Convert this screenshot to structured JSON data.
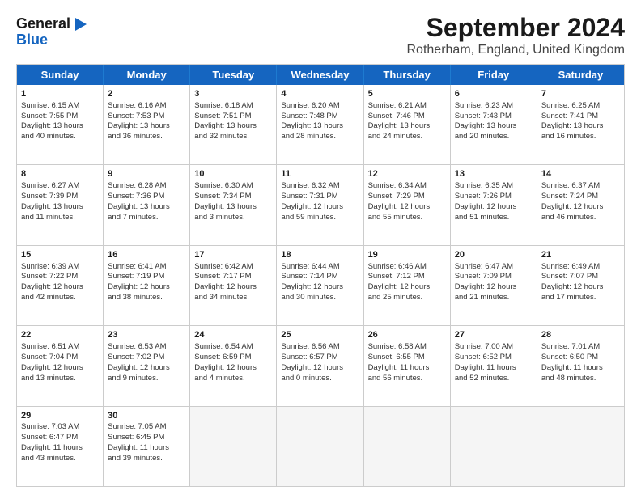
{
  "header": {
    "logo_line1": "General",
    "logo_line2": "Blue",
    "title": "September 2024",
    "subtitle": "Rotherham, England, United Kingdom"
  },
  "calendar": {
    "days_of_week": [
      "Sunday",
      "Monday",
      "Tuesday",
      "Wednesday",
      "Thursday",
      "Friday",
      "Saturday"
    ],
    "weeks": [
      [
        {
          "day": "",
          "sunrise": "",
          "sunset": "",
          "daylight": "",
          "empty": true
        },
        {
          "day": "",
          "sunrise": "",
          "sunset": "",
          "daylight": "",
          "empty": true
        },
        {
          "day": "",
          "sunrise": "",
          "sunset": "",
          "daylight": "",
          "empty": true
        },
        {
          "day": "",
          "sunrise": "",
          "sunset": "",
          "daylight": "",
          "empty": true
        },
        {
          "day": "",
          "sunrise": "",
          "sunset": "",
          "daylight": "",
          "empty": true
        },
        {
          "day": "",
          "sunrise": "",
          "sunset": "",
          "daylight": "",
          "empty": true
        },
        {
          "day": "",
          "sunrise": "",
          "sunset": "",
          "daylight": "",
          "empty": true
        }
      ],
      [
        {
          "day": "1",
          "sunrise": "Sunrise: 6:15 AM",
          "sunset": "Sunset: 7:55 PM",
          "daylight": "Daylight: 13 hours",
          "daylight2": "and 40 minutes.",
          "empty": false
        },
        {
          "day": "2",
          "sunrise": "Sunrise: 6:16 AM",
          "sunset": "Sunset: 7:53 PM",
          "daylight": "Daylight: 13 hours",
          "daylight2": "and 36 minutes.",
          "empty": false
        },
        {
          "day": "3",
          "sunrise": "Sunrise: 6:18 AM",
          "sunset": "Sunset: 7:51 PM",
          "daylight": "Daylight: 13 hours",
          "daylight2": "and 32 minutes.",
          "empty": false
        },
        {
          "day": "4",
          "sunrise": "Sunrise: 6:20 AM",
          "sunset": "Sunset: 7:48 PM",
          "daylight": "Daylight: 13 hours",
          "daylight2": "and 28 minutes.",
          "empty": false
        },
        {
          "day": "5",
          "sunrise": "Sunrise: 6:21 AM",
          "sunset": "Sunset: 7:46 PM",
          "daylight": "Daylight: 13 hours",
          "daylight2": "and 24 minutes.",
          "empty": false
        },
        {
          "day": "6",
          "sunrise": "Sunrise: 6:23 AM",
          "sunset": "Sunset: 7:43 PM",
          "daylight": "Daylight: 13 hours",
          "daylight2": "and 20 minutes.",
          "empty": false
        },
        {
          "day": "7",
          "sunrise": "Sunrise: 6:25 AM",
          "sunset": "Sunset: 7:41 PM",
          "daylight": "Daylight: 13 hours",
          "daylight2": "and 16 minutes.",
          "empty": false
        }
      ],
      [
        {
          "day": "8",
          "sunrise": "Sunrise: 6:27 AM",
          "sunset": "Sunset: 7:39 PM",
          "daylight": "Daylight: 13 hours",
          "daylight2": "and 11 minutes.",
          "empty": false
        },
        {
          "day": "9",
          "sunrise": "Sunrise: 6:28 AM",
          "sunset": "Sunset: 7:36 PM",
          "daylight": "Daylight: 13 hours",
          "daylight2": "and 7 minutes.",
          "empty": false
        },
        {
          "day": "10",
          "sunrise": "Sunrise: 6:30 AM",
          "sunset": "Sunset: 7:34 PM",
          "daylight": "Daylight: 13 hours",
          "daylight2": "and 3 minutes.",
          "empty": false
        },
        {
          "day": "11",
          "sunrise": "Sunrise: 6:32 AM",
          "sunset": "Sunset: 7:31 PM",
          "daylight": "Daylight: 12 hours",
          "daylight2": "and 59 minutes.",
          "empty": false
        },
        {
          "day": "12",
          "sunrise": "Sunrise: 6:34 AM",
          "sunset": "Sunset: 7:29 PM",
          "daylight": "Daylight: 12 hours",
          "daylight2": "and 55 minutes.",
          "empty": false
        },
        {
          "day": "13",
          "sunrise": "Sunrise: 6:35 AM",
          "sunset": "Sunset: 7:26 PM",
          "daylight": "Daylight: 12 hours",
          "daylight2": "and 51 minutes.",
          "empty": false
        },
        {
          "day": "14",
          "sunrise": "Sunrise: 6:37 AM",
          "sunset": "Sunset: 7:24 PM",
          "daylight": "Daylight: 12 hours",
          "daylight2": "and 46 minutes.",
          "empty": false
        }
      ],
      [
        {
          "day": "15",
          "sunrise": "Sunrise: 6:39 AM",
          "sunset": "Sunset: 7:22 PM",
          "daylight": "Daylight: 12 hours",
          "daylight2": "and 42 minutes.",
          "empty": false
        },
        {
          "day": "16",
          "sunrise": "Sunrise: 6:41 AM",
          "sunset": "Sunset: 7:19 PM",
          "daylight": "Daylight: 12 hours",
          "daylight2": "and 38 minutes.",
          "empty": false
        },
        {
          "day": "17",
          "sunrise": "Sunrise: 6:42 AM",
          "sunset": "Sunset: 7:17 PM",
          "daylight": "Daylight: 12 hours",
          "daylight2": "and 34 minutes.",
          "empty": false
        },
        {
          "day": "18",
          "sunrise": "Sunrise: 6:44 AM",
          "sunset": "Sunset: 7:14 PM",
          "daylight": "Daylight: 12 hours",
          "daylight2": "and 30 minutes.",
          "empty": false
        },
        {
          "day": "19",
          "sunrise": "Sunrise: 6:46 AM",
          "sunset": "Sunset: 7:12 PM",
          "daylight": "Daylight: 12 hours",
          "daylight2": "and 25 minutes.",
          "empty": false
        },
        {
          "day": "20",
          "sunrise": "Sunrise: 6:47 AM",
          "sunset": "Sunset: 7:09 PM",
          "daylight": "Daylight: 12 hours",
          "daylight2": "and 21 minutes.",
          "empty": false
        },
        {
          "day": "21",
          "sunrise": "Sunrise: 6:49 AM",
          "sunset": "Sunset: 7:07 PM",
          "daylight": "Daylight: 12 hours",
          "daylight2": "and 17 minutes.",
          "empty": false
        }
      ],
      [
        {
          "day": "22",
          "sunrise": "Sunrise: 6:51 AM",
          "sunset": "Sunset: 7:04 PM",
          "daylight": "Daylight: 12 hours",
          "daylight2": "and 13 minutes.",
          "empty": false
        },
        {
          "day": "23",
          "sunrise": "Sunrise: 6:53 AM",
          "sunset": "Sunset: 7:02 PM",
          "daylight": "Daylight: 12 hours",
          "daylight2": "and 9 minutes.",
          "empty": false
        },
        {
          "day": "24",
          "sunrise": "Sunrise: 6:54 AM",
          "sunset": "Sunset: 6:59 PM",
          "daylight": "Daylight: 12 hours",
          "daylight2": "and 4 minutes.",
          "empty": false
        },
        {
          "day": "25",
          "sunrise": "Sunrise: 6:56 AM",
          "sunset": "Sunset: 6:57 PM",
          "daylight": "Daylight: 12 hours",
          "daylight2": "and 0 minutes.",
          "empty": false
        },
        {
          "day": "26",
          "sunrise": "Sunrise: 6:58 AM",
          "sunset": "Sunset: 6:55 PM",
          "daylight": "Daylight: 11 hours",
          "daylight2": "and 56 minutes.",
          "empty": false
        },
        {
          "day": "27",
          "sunrise": "Sunrise: 7:00 AM",
          "sunset": "Sunset: 6:52 PM",
          "daylight": "Daylight: 11 hours",
          "daylight2": "and 52 minutes.",
          "empty": false
        },
        {
          "day": "28",
          "sunrise": "Sunrise: 7:01 AM",
          "sunset": "Sunset: 6:50 PM",
          "daylight": "Daylight: 11 hours",
          "daylight2": "and 48 minutes.",
          "empty": false
        }
      ],
      [
        {
          "day": "29",
          "sunrise": "Sunrise: 7:03 AM",
          "sunset": "Sunset: 6:47 PM",
          "daylight": "Daylight: 11 hours",
          "daylight2": "and 43 minutes.",
          "empty": false
        },
        {
          "day": "30",
          "sunrise": "Sunrise: 7:05 AM",
          "sunset": "Sunset: 6:45 PM",
          "daylight": "Daylight: 11 hours",
          "daylight2": "and 39 minutes.",
          "empty": false
        },
        {
          "day": "",
          "sunrise": "",
          "sunset": "",
          "daylight": "",
          "daylight2": "",
          "empty": true
        },
        {
          "day": "",
          "sunrise": "",
          "sunset": "",
          "daylight": "",
          "daylight2": "",
          "empty": true
        },
        {
          "day": "",
          "sunrise": "",
          "sunset": "",
          "daylight": "",
          "daylight2": "",
          "empty": true
        },
        {
          "day": "",
          "sunrise": "",
          "sunset": "",
          "daylight": "",
          "daylight2": "",
          "empty": true
        },
        {
          "day": "",
          "sunrise": "",
          "sunset": "",
          "daylight": "",
          "daylight2": "",
          "empty": true
        }
      ]
    ]
  }
}
